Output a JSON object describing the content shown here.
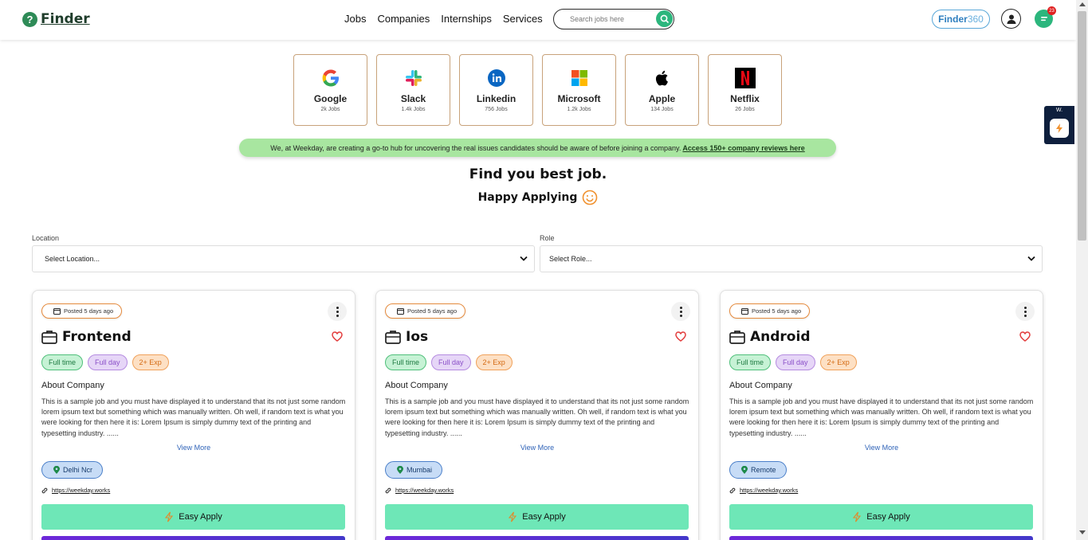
{
  "header": {
    "logo_text": "Finder",
    "logo_mark": "?",
    "nav": [
      "Jobs",
      "Companies",
      "Internships",
      "Services"
    ],
    "search_placeholder": "Search jobs here",
    "finder360_main": "Finder",
    "finder360_num": "360",
    "notification_count": "23",
    "accent": "#2cb67d"
  },
  "companies": [
    {
      "name": "Google",
      "jobs": "2k Jobs",
      "icon": "google-icon"
    },
    {
      "name": "Slack",
      "jobs": "1.4k Jobs",
      "icon": "slack-icon"
    },
    {
      "name": "Linkedin",
      "jobs": "756 Jobs",
      "icon": "linkedin-icon"
    },
    {
      "name": "Microsoft",
      "jobs": "1.2k Jobs",
      "icon": "microsoft-icon"
    },
    {
      "name": "Apple",
      "jobs": "134 Jobs",
      "icon": "apple-icon"
    },
    {
      "name": "Netflix",
      "jobs": "26 Jobs",
      "icon": "netflix-icon"
    }
  ],
  "banner": {
    "text": "We, at Weekday, are creating a go-to hub for uncovering the real issues candidates should be aware of before joining a company.",
    "link": "Access 150+ company reviews here"
  },
  "headline": "Find you best job.",
  "subline": "Happy Applying",
  "filters": {
    "location_label": "Location",
    "location_value": "Select Location...",
    "role_label": "Role",
    "role_value": "Select Role..."
  },
  "widget": {
    "label": "W."
  },
  "jobs": [
    {
      "posted": "Posted 5 days ago",
      "title": "Frontend",
      "tags": [
        "Full time",
        "Full day",
        "2+ Exp"
      ],
      "about": "About Company",
      "description": "This is a sample job and you must have displayed it to understand that its not just some random lorem ipsum text but something which was manually written. Oh well, if random text is what you were looking for then here it is: Lorem Ipsum is simply dummy text of the printing and typesetting industry. ......",
      "view_more": "View More",
      "location": "Delhi Ncr",
      "link": "https://weekday.works",
      "apply": "Easy Apply"
    },
    {
      "posted": "Posted 5 days ago",
      "title": "Ios",
      "tags": [
        "Full time",
        "Full day",
        "2+ Exp"
      ],
      "about": "About Company",
      "description": "This is a sample job and you must have displayed it to understand that its not just some random lorem ipsum text but something which was manually written. Oh well, if random text is what you were looking for then here it is: Lorem Ipsum is simply dummy text of the printing and typesetting industry. ......",
      "view_more": "View More",
      "location": "Mumbai",
      "link": "https://weekday.works",
      "apply": "Easy Apply"
    },
    {
      "posted": "Posted 5 days ago",
      "title": "Android",
      "tags": [
        "Full time",
        "Full day",
        "2+ Exp"
      ],
      "about": "About Company",
      "description": "This is a sample job and you must have displayed it to understand that its not just some random lorem ipsum text but something which was manually written. Oh well, if random text is what you were looking for then here it is: Lorem Ipsum is simply dummy text of the printing and typesetting industry. ......",
      "view_more": "View More",
      "location": "Remote",
      "link": "https://weekday.works",
      "apply": "Easy Apply"
    }
  ]
}
